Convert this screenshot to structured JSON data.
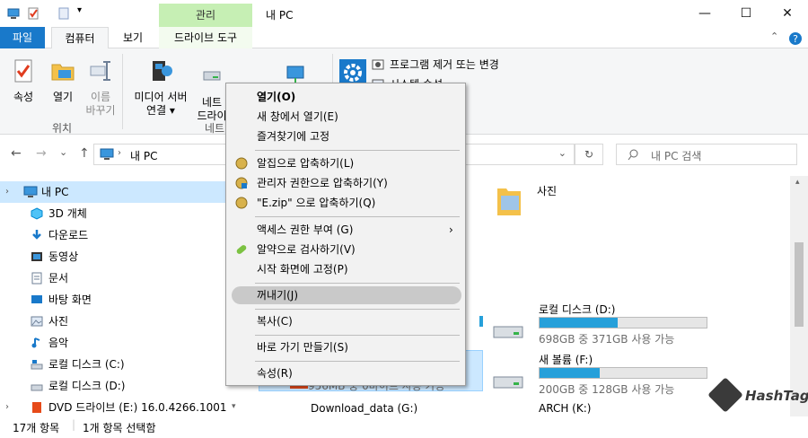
{
  "titlebar": {
    "manage_label": "관리",
    "window_title": "내 PC",
    "minimize": "—",
    "maximize": "☐",
    "close": "✕"
  },
  "ribbon_tabs": {
    "file": "파일",
    "computer": "컴퓨터",
    "view": "보기",
    "drive_tools": "드라이브 도구"
  },
  "ribbon": {
    "location": {
      "properties": "속성",
      "open": "열기",
      "rename_1": "이름",
      "rename_2": "바꾸기",
      "group_label": "위치"
    },
    "network": {
      "media_1": "미디어 서버",
      "media_2": "연결 ▾",
      "map_1": "네트",
      "map_2": "드라이",
      "group_label": "네트"
    },
    "system": {
      "uninstall": "프로그램 제거 또는 변경",
      "sysprop": "시스템 속성"
    }
  },
  "navbar": {
    "back": "←",
    "forward": "→",
    "recent": "⌄",
    "up": "↑",
    "path": "내 PC",
    "dropdown": "⌄",
    "refresh": "↻",
    "search_placeholder": "내 PC 검색"
  },
  "nav_pane": {
    "items": [
      {
        "label": "내 PC"
      },
      {
        "label": "3D 개체"
      },
      {
        "label": "다운로드"
      },
      {
        "label": "동영상"
      },
      {
        "label": "문서"
      },
      {
        "label": "바탕 화면"
      },
      {
        "label": "사진"
      },
      {
        "label": "음악"
      },
      {
        "label": "로컬 디스크 (C:)"
      },
      {
        "label": "로컬 디스크 (D:)"
      },
      {
        "label": "DVD 드라이브 (E:) 16.0.4266.1001"
      }
    ]
  },
  "content": {
    "photos": "사진",
    "drive_d": {
      "name": "로컬 디스크 (D:)",
      "sub": "698GB 중 371GB 사용 가능",
      "used_fraction": 0.47
    },
    "drive_f": {
      "name": "새 볼륨 (F:)",
      "sub": "200GB 중 128GB 사용 가능",
      "used_fraction": 0.36
    },
    "drive_e_sub": "956MB 중 0바이트 사용 가능",
    "drive_g": "Download_data (G:)",
    "drive_k": "ARCH (K:)"
  },
  "context_menu": {
    "open": "열기(O)",
    "open_new": "새 창에서 열기(E)",
    "pin_quick": "즐겨찾기에 고정",
    "alzip": "알집으로 압축하기(L)",
    "alzip_admin": "관리자 권한으로 압축하기(Y)",
    "alzip_zip": "\"E.zip\" 으로 압축하기(Q)",
    "give_access": "액세스 권한 부여 (G)",
    "alyac": "알약으로 검사하기(V)",
    "pin_start": "시작 화면에 고정(P)",
    "eject": "꺼내기(J)",
    "copy": "복사(C)",
    "shortcut": "바로 가기 만들기(S)",
    "properties": "속성(R)"
  },
  "status": {
    "count": "17개 항목",
    "selected": "1개 항목 선택함"
  },
  "watermark": "HashTag",
  "colors": {
    "accent": "#1979ca",
    "manage_tab": "#c6efb4",
    "bar_fill": "#26a0da",
    "selection": "#cce8ff"
  }
}
